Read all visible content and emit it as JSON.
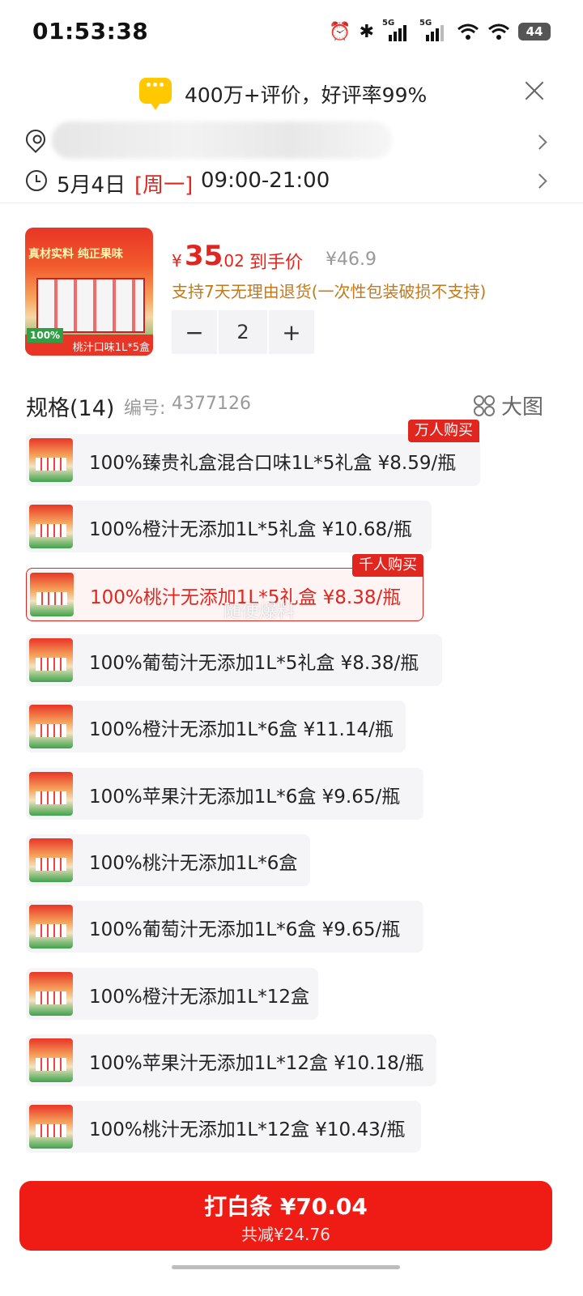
{
  "status_bar": {
    "time": "01:53:38",
    "battery": "44",
    "sig1": "5G",
    "sig2": "5G"
  },
  "review_banner": {
    "text": "400万+评价，好评率99%"
  },
  "delivery": {
    "date": "5月4日",
    "weekday": "[周一]",
    "hours": "09:00-21:00"
  },
  "product": {
    "image_tag": "真材实料 纯正果味",
    "image_badge": "100%",
    "image_caption": "桃汁口味1L*5盒",
    "price_symbol": "¥",
    "price_int": "35",
    "price_dec": ".02",
    "price_label": "到手价",
    "original_price": "¥46.9",
    "return_policy": "支持7天无理由退货(一次性包装破损不支持)",
    "quantity": "2",
    "minus": "−",
    "plus": "+"
  },
  "spec": {
    "title": "规格(14)",
    "code_label": "编号:",
    "code": "4377126",
    "big_view": "大图",
    "items": [
      {
        "label": "100%臻贵礼盒混合口味1L*5礼盒  ¥8.59/瓶",
        "badge": "万人购买"
      },
      {
        "label": "100%橙汁无添加1L*5礼盒  ¥10.68/瓶",
        "badge": ""
      },
      {
        "label": "100%桃汁无添加1L*5礼盒  ¥8.38/瓶",
        "badge": "千人购买"
      },
      {
        "label": "100%葡萄汁无添加1L*5礼盒  ¥8.38/瓶",
        "badge": ""
      },
      {
        "label": "100%橙汁无添加1L*6盒  ¥11.14/瓶",
        "badge": ""
      },
      {
        "label": "100%苹果汁无添加1L*6盒  ¥9.65/瓶",
        "badge": ""
      },
      {
        "label": "100%桃汁无添加1L*6盒",
        "badge": ""
      },
      {
        "label": "100%葡萄汁无添加1L*6盒  ¥9.65/瓶",
        "badge": ""
      },
      {
        "label": "100%橙汁无添加1L*12盒",
        "badge": ""
      },
      {
        "label": "100%苹果汁无添加1L*12盒  ¥10.18/瓶",
        "badge": ""
      },
      {
        "label": "100%桃汁无添加1L*12盒  ¥10.43/瓶",
        "badge": ""
      }
    ],
    "watermark": "随便爆料"
  },
  "buy_button": {
    "main": "打白条 ¥70.04",
    "sub": "共减¥24.76"
  },
  "colors": {
    "accent": "#e0261e",
    "button": "#ee1c14",
    "policy": "#c27a1c"
  }
}
